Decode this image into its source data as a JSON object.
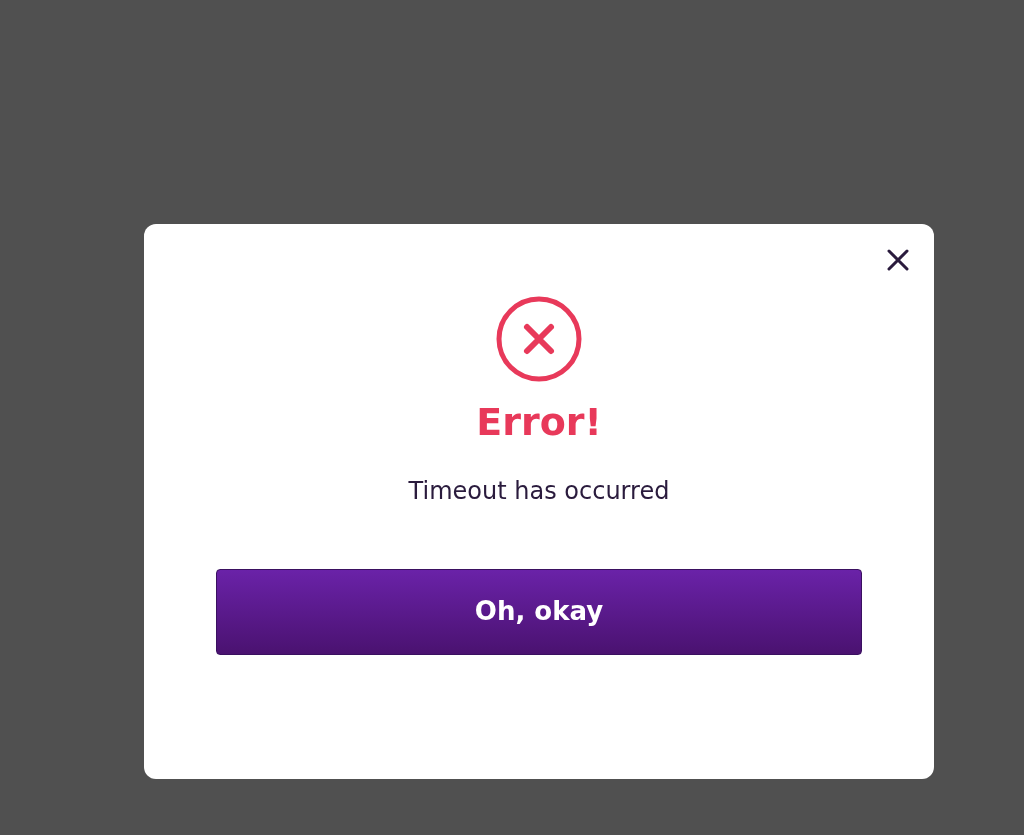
{
  "dialog": {
    "title": "Error!",
    "message": "Timeout has occurred",
    "button": "Oh, okay"
  }
}
